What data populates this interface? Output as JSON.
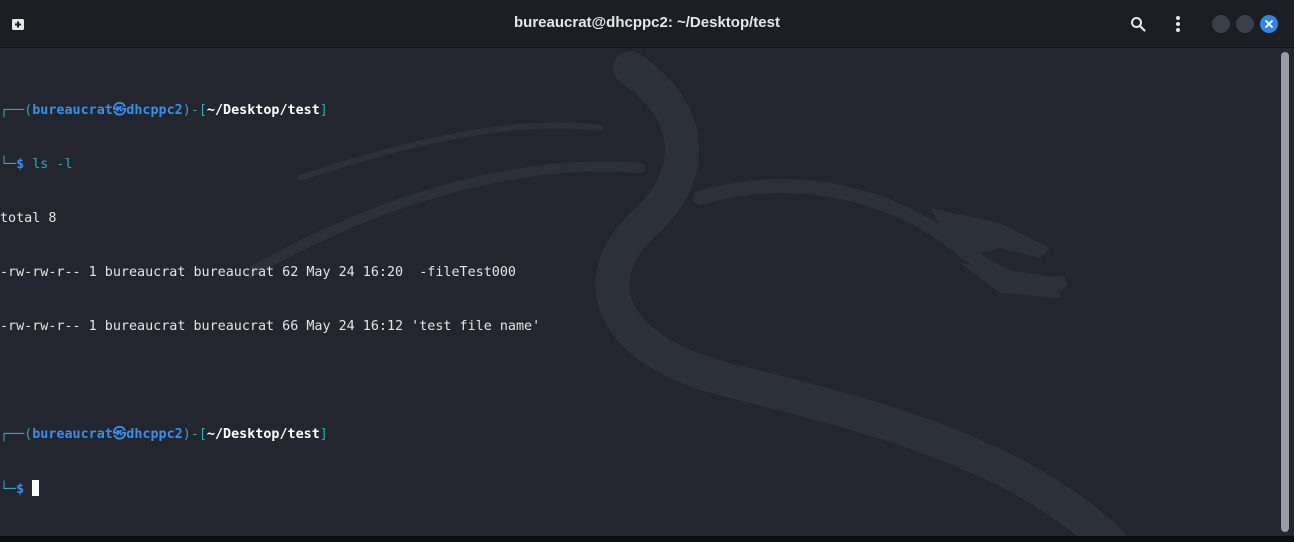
{
  "window": {
    "title": "bureaucrat@dhcppc2: ~/Desktop/test"
  },
  "icons": {
    "new_tab": "new-tab-icon",
    "search": "search-icon",
    "menu": "kebab-menu-icon",
    "minimize": "minimize-icon",
    "maximize": "maximize-icon",
    "close": "close-icon"
  },
  "colors": {
    "accent": "#3584e4",
    "prompt_teal": "#2ea7b8",
    "prompt_blue": "#3b8eea"
  },
  "terminal": {
    "prompt1": {
      "corner_top": "┌──(",
      "user": "bureaucrat",
      "skull": "㉿",
      "host": "dhcppc2",
      "mid": ")-[",
      "path": "~/Desktop/test",
      "end": "]",
      "corner_bottom": "└─",
      "symbol": "$",
      "command": " ls -l"
    },
    "output": [
      "total 8",
      "-rw-rw-r-- 1 bureaucrat bureaucrat 62 May 24 16:20  -fileTest000",
      "-rw-rw-r-- 1 bureaucrat bureaucrat 66 May 24 16:12 'test file name'"
    ],
    "prompt2": {
      "corner_top": "┌──(",
      "user": "bureaucrat",
      "skull": "㉿",
      "host": "dhcppc2",
      "mid": ")-[",
      "path": "~/Desktop/test",
      "end": "]",
      "corner_bottom": "└─",
      "symbol": "$"
    }
  }
}
